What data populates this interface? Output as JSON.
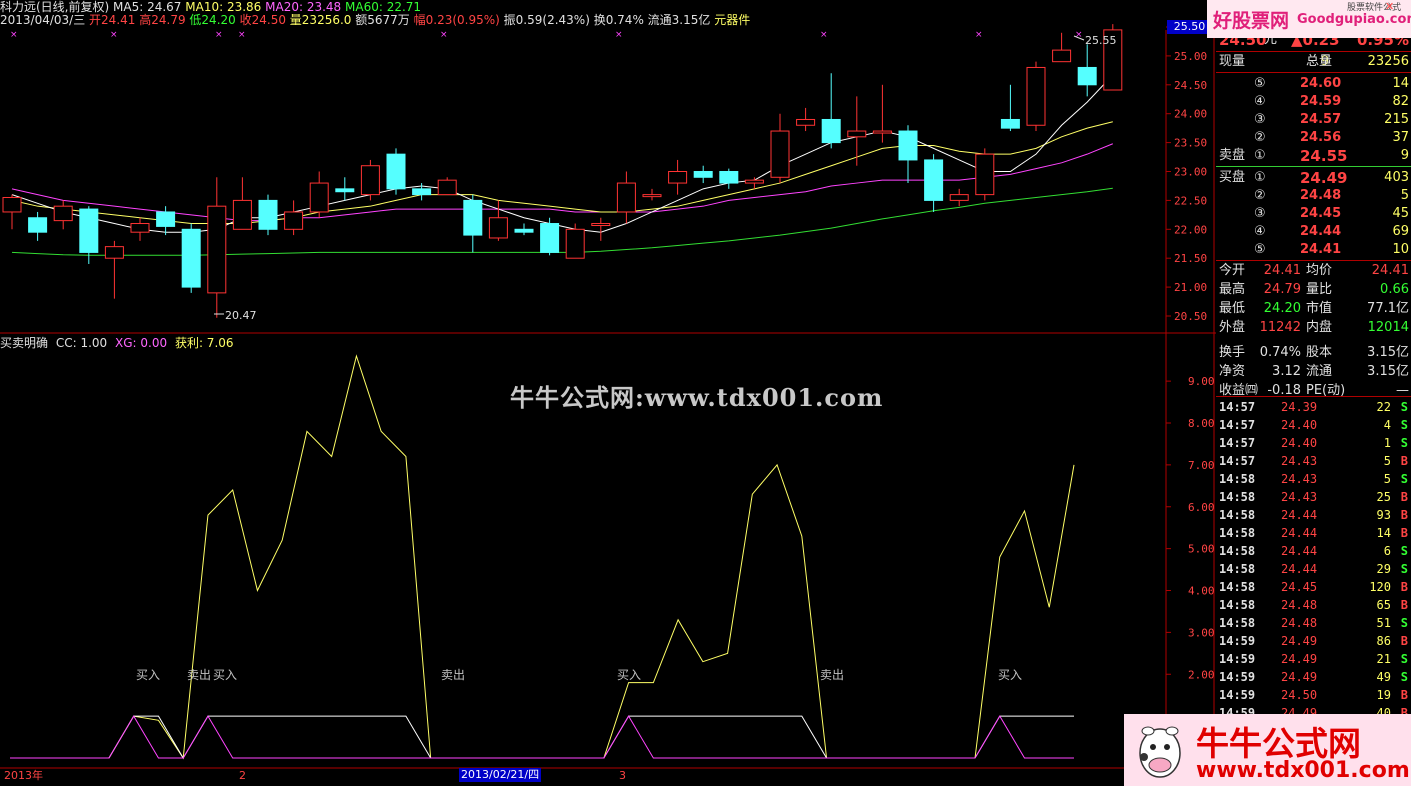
{
  "title": "科力远(日线,前复权)",
  "header": {
    "ma5": "MA5: 24.67",
    "ma10": "MA10: 23.86",
    "ma20": "MA20: 23.48",
    "ma60": "MA60: 22.71",
    "date": "2013/04/03/三",
    "open": "开24.41",
    "high": "高24.79",
    "low": "低24.20",
    "close": "收24.50",
    "vol": "量23256.0",
    "amount": "额5677万",
    "chg": "幅0.23(0.95%)",
    "amp": "振0.59(2.43%)",
    "turnover": "换0.74%",
    "float": "流通3.15亿",
    "sector": "元器件"
  },
  "price_axis": {
    "labels": [
      "25.50",
      "25.00",
      "24.50",
      "24.00",
      "23.50",
      "23.00",
      "22.50",
      "22.00",
      "21.50",
      "21.00",
      "20.50"
    ],
    "current_tag": "25.50",
    "high_mark": "25.55",
    "low_mark": "20.47"
  },
  "osc": {
    "name": "买卖明确",
    "cc": "CC: 1.00",
    "xg": "XG: 0.00",
    "profit": "获利: 7.06",
    "axis": [
      "9.00",
      "8.00",
      "7.00",
      "6.00",
      "5.00",
      "4.00",
      "3.00",
      "2.00"
    ],
    "signals": [
      {
        "text": "买入",
        "color": "#ff4444"
      },
      {
        "text": "卖出",
        "color": "#33ff33"
      },
      {
        "text": "买入",
        "color": "#ff4444"
      },
      {
        "text": "卖出",
        "color": "#33ff33"
      },
      {
        "text": "买入",
        "color": "#ff4444"
      },
      {
        "text": "卖出",
        "color": "#33ff33"
      },
      {
        "text": "买入",
        "color": "#ff4444"
      }
    ],
    "values": [
      0,
      0,
      0,
      0,
      0,
      1.0,
      0.9,
      0,
      5.8,
      6.4,
      4.0,
      5.2,
      7.8,
      7.2,
      9.6,
      7.8,
      7.2,
      0,
      0,
      0,
      0,
      0,
      0,
      0,
      0,
      1.8,
      1.8,
      3.3,
      2.3,
      2.5,
      6.3,
      7.0,
      5.3,
      0,
      0,
      0,
      0,
      0,
      0,
      0,
      4.8,
      5.9,
      3.6,
      7.0
    ]
  },
  "bottom_axis": {
    "year": "2013年",
    "m2": "2",
    "selected": "2013/02/21/四",
    "m3": "3"
  },
  "quote": {
    "price": "24.50",
    "unit": "元",
    "change": "▲0.23",
    "pct": "0.95%",
    "xianliang_label": "现量",
    "xianliang": "9",
    "zongliang_label": "总量",
    "zongliang": "23256",
    "sell_label": "卖盘",
    "buy_label": "买盘",
    "asks": [
      {
        "lvl": "⑤",
        "price": "24.60",
        "vol": "14"
      },
      {
        "lvl": "④",
        "price": "24.59",
        "vol": "82"
      },
      {
        "lvl": "③",
        "price": "24.57",
        "vol": "215"
      },
      {
        "lvl": "②",
        "price": "24.56",
        "vol": "37"
      },
      {
        "lvl": "①",
        "price": "24.55",
        "vol": "9"
      }
    ],
    "bids": [
      {
        "lvl": "①",
        "price": "24.49",
        "vol": "403"
      },
      {
        "lvl": "②",
        "price": "24.48",
        "vol": "5"
      },
      {
        "lvl": "③",
        "price": "24.45",
        "vol": "45"
      },
      {
        "lvl": "④",
        "price": "24.44",
        "vol": "69"
      },
      {
        "lvl": "⑤",
        "price": "24.41",
        "vol": "10"
      }
    ],
    "stats": [
      {
        "l1": "今开",
        "v1": "24.41",
        "l2": "均价",
        "v2": "24.41",
        "c1": "#ff4444",
        "c2": "#ff4444"
      },
      {
        "l1": "最高",
        "v1": "24.79",
        "l2": "量比",
        "v2": "0.66",
        "c1": "#ff4444",
        "c2": "#33ff33"
      },
      {
        "l1": "最低",
        "v1": "24.20",
        "l2": "市值",
        "v2": "77.1亿",
        "c1": "#33ff33",
        "c2": "#e0e0e0"
      },
      {
        "l1": "外盘",
        "v1": "11242",
        "l2": "内盘",
        "v2": "12014",
        "c1": "#ff4444",
        "c2": "#33ff33"
      },
      {
        "l1": "换手",
        "v1": "0.74%",
        "l2": "股本",
        "v2": "3.15亿",
        "c1": "#e0e0e0",
        "c2": "#e0e0e0"
      },
      {
        "l1": "净资",
        "v1": "3.12",
        "l2": "流通",
        "v2": "3.15亿",
        "c1": "#e0e0e0",
        "c2": "#e0e0e0"
      },
      {
        "l1": "收益㈣",
        "v1": "-0.18",
        "l2": "PE(动)",
        "v2": "—",
        "c1": "#e0e0e0",
        "c2": "#e0e0e0"
      }
    ],
    "ticks": [
      {
        "t": "14:57",
        "p": "24.39",
        "v": "22",
        "bs": "S"
      },
      {
        "t": "14:57",
        "p": "24.40",
        "v": "4",
        "bs": "S"
      },
      {
        "t": "14:57",
        "p": "24.40",
        "v": "1",
        "bs": "S"
      },
      {
        "t": "14:57",
        "p": "24.43",
        "v": "5",
        "bs": "B"
      },
      {
        "t": "14:58",
        "p": "24.43",
        "v": "5",
        "bs": "S"
      },
      {
        "t": "14:58",
        "p": "24.43",
        "v": "25",
        "bs": "B"
      },
      {
        "t": "14:58",
        "p": "24.44",
        "v": "93",
        "bs": "B"
      },
      {
        "t": "14:58",
        "p": "24.44",
        "v": "14",
        "bs": "B"
      },
      {
        "t": "14:58",
        "p": "24.44",
        "v": "6",
        "bs": "S"
      },
      {
        "t": "14:58",
        "p": "24.44",
        "v": "29",
        "bs": "S"
      },
      {
        "t": "14:58",
        "p": "24.45",
        "v": "120",
        "bs": "B"
      },
      {
        "t": "14:58",
        "p": "24.48",
        "v": "65",
        "bs": "B"
      },
      {
        "t": "14:58",
        "p": "24.48",
        "v": "51",
        "bs": "S"
      },
      {
        "t": "14:59",
        "p": "24.49",
        "v": "86",
        "bs": "B"
      },
      {
        "t": "14:59",
        "p": "24.49",
        "v": "21",
        "bs": "S"
      },
      {
        "t": "14:59",
        "p": "24.49",
        "v": "49",
        "bs": "S"
      },
      {
        "t": "14:59",
        "p": "24.50",
        "v": "19",
        "bs": "B"
      },
      {
        "t": "14:59",
        "p": "24.49",
        "v": "40",
        "bs": "B"
      }
    ]
  },
  "watermark": "牛牛公式网:www.tdx001.com",
  "brand_top": "好股票网",
  "brand_top_url": "Goodgupiao.com",
  "brand_top_sub": "股票软件公式",
  "brand_bottom": "牛牛公式网",
  "brand_bottom_url": "www.tdx001.com",
  "candles": [
    {
      "o": 22.3,
      "c": 22.55,
      "h": 22.6,
      "l": 22.0
    },
    {
      "o": 22.2,
      "c": 21.95,
      "h": 22.3,
      "l": 21.8
    },
    {
      "o": 22.15,
      "c": 22.4,
      "h": 22.5,
      "l": 22.0
    },
    {
      "o": 22.35,
      "c": 21.6,
      "h": 22.4,
      "l": 21.4
    },
    {
      "o": 21.5,
      "c": 21.7,
      "h": 21.8,
      "l": 20.8
    },
    {
      "o": 21.95,
      "c": 22.1,
      "h": 22.2,
      "l": 21.8
    },
    {
      "o": 22.3,
      "c": 22.05,
      "h": 22.4,
      "l": 21.9
    },
    {
      "o": 22.0,
      "c": 21.0,
      "h": 22.1,
      "l": 20.9
    },
    {
      "o": 20.9,
      "c": 22.4,
      "h": 22.9,
      "l": 20.47
    },
    {
      "o": 22.0,
      "c": 22.5,
      "h": 22.9,
      "l": 22.0
    },
    {
      "o": 22.5,
      "c": 22.0,
      "h": 22.6,
      "l": 21.9
    },
    {
      "o": 22.0,
      "c": 22.3,
      "h": 22.5,
      "l": 21.9
    },
    {
      "o": 22.3,
      "c": 22.8,
      "h": 23.0,
      "l": 22.2
    },
    {
      "o": 22.7,
      "c": 22.65,
      "h": 22.9,
      "l": 22.5
    },
    {
      "o": 22.6,
      "c": 23.1,
      "h": 23.2,
      "l": 22.5
    },
    {
      "o": 23.3,
      "c": 22.7,
      "h": 23.4,
      "l": 22.6
    },
    {
      "o": 22.7,
      "c": 22.6,
      "h": 22.8,
      "l": 22.5
    },
    {
      "o": 22.6,
      "c": 22.85,
      "h": 22.9,
      "l": 22.6
    },
    {
      "o": 22.5,
      "c": 21.9,
      "h": 22.6,
      "l": 21.6
    },
    {
      "o": 21.85,
      "c": 22.2,
      "h": 22.5,
      "l": 21.8
    },
    {
      "o": 22.0,
      "c": 21.95,
      "h": 22.1,
      "l": 21.9
    },
    {
      "o": 22.1,
      "c": 21.6,
      "h": 22.2,
      "l": 21.55
    },
    {
      "o": 21.5,
      "c": 22.0,
      "h": 22.1,
      "l": 21.5
    },
    {
      "o": 22.1,
      "c": 22.1,
      "h": 22.2,
      "l": 21.8
    },
    {
      "o": 22.3,
      "c": 22.8,
      "h": 23.0,
      "l": 22.1
    },
    {
      "o": 22.6,
      "c": 22.6,
      "h": 22.7,
      "l": 22.5
    },
    {
      "o": 22.8,
      "c": 23.0,
      "h": 23.2,
      "l": 22.6
    },
    {
      "o": 23.0,
      "c": 22.9,
      "h": 23.1,
      "l": 22.8
    },
    {
      "o": 23.0,
      "c": 22.8,
      "h": 23.05,
      "l": 22.7
    },
    {
      "o": 22.8,
      "c": 22.85,
      "h": 22.9,
      "l": 22.7
    },
    {
      "o": 22.9,
      "c": 23.7,
      "h": 24.0,
      "l": 22.8
    },
    {
      "o": 23.8,
      "c": 23.9,
      "h": 24.1,
      "l": 23.7
    },
    {
      "o": 23.9,
      "c": 23.5,
      "h": 24.7,
      "l": 23.4
    },
    {
      "o": 23.6,
      "c": 23.7,
      "h": 24.3,
      "l": 23.1
    },
    {
      "o": 23.7,
      "c": 23.7,
      "h": 24.5,
      "l": 23.5
    },
    {
      "o": 23.7,
      "c": 23.2,
      "h": 23.8,
      "l": 22.8
    },
    {
      "o": 23.2,
      "c": 22.5,
      "h": 23.3,
      "l": 22.3
    },
    {
      "o": 22.5,
      "c": 22.6,
      "h": 22.7,
      "l": 22.4
    },
    {
      "o": 22.6,
      "c": 23.3,
      "h": 23.4,
      "l": 22.5
    },
    {
      "o": 23.9,
      "c": 23.75,
      "h": 24.5,
      "l": 23.7
    },
    {
      "o": 23.8,
      "c": 24.8,
      "h": 24.9,
      "l": 23.7
    },
    {
      "o": 24.9,
      "c": 25.1,
      "h": 25.4,
      "l": 24.9
    },
    {
      "o": 24.8,
      "c": 24.5,
      "h": 25.2,
      "l": 24.3
    },
    {
      "o": 24.41,
      "c": 25.45,
      "h": 25.55,
      "l": 24.41
    }
  ],
  "ma_series": {
    "ma5": [
      22.6,
      22.45,
      22.3,
      22.2,
      22.1,
      22.0,
      21.95,
      21.95,
      22.0,
      22.2,
      22.2,
      22.3,
      22.4,
      22.5,
      22.6,
      22.7,
      22.75,
      22.7,
      22.5,
      22.35,
      22.2,
      22.1,
      22.0,
      21.95,
      22.1,
      22.3,
      22.5,
      22.7,
      22.8,
      22.85,
      23.1,
      23.3,
      23.5,
      23.6,
      23.7,
      23.6,
      23.4,
      23.2,
      23.0,
      23.0,
      23.3,
      23.8,
      24.2,
      24.67
    ],
    "ma10": [
      22.5,
      22.4,
      22.35,
      22.3,
      22.25,
      22.2,
      22.15,
      22.1,
      22.1,
      22.1,
      22.15,
      22.2,
      22.3,
      22.35,
      22.4,
      22.5,
      22.6,
      22.6,
      22.6,
      22.5,
      22.45,
      22.4,
      22.35,
      22.3,
      22.3,
      22.35,
      22.4,
      22.5,
      22.6,
      22.7,
      22.8,
      22.95,
      23.1,
      23.25,
      23.4,
      23.45,
      23.45,
      23.35,
      23.3,
      23.3,
      23.4,
      23.6,
      23.75,
      23.86
    ],
    "ma20": [
      22.7,
      22.6,
      22.5,
      22.45,
      22.4,
      22.35,
      22.3,
      22.25,
      22.2,
      22.15,
      22.15,
      22.2,
      22.2,
      22.25,
      22.3,
      22.35,
      22.35,
      22.35,
      22.35,
      22.35,
      22.35,
      22.35,
      22.3,
      22.3,
      22.3,
      22.3,
      22.35,
      22.4,
      22.5,
      22.55,
      22.6,
      22.65,
      22.75,
      22.8,
      22.85,
      22.85,
      22.85,
      22.85,
      22.9,
      22.95,
      23.05,
      23.15,
      23.3,
      23.48
    ],
    "ma60": [
      21.6,
      21.58,
      21.56,
      21.55,
      21.55,
      21.55,
      21.55,
      21.55,
      21.56,
      21.57,
      21.58,
      21.59,
      21.6,
      21.6,
      21.6,
      21.6,
      21.6,
      21.6,
      21.6,
      21.6,
      21.6,
      21.6,
      21.6,
      21.62,
      21.65,
      21.68,
      21.72,
      21.76,
      21.8,
      21.85,
      21.9,
      21.96,
      22.02,
      22.1,
      22.18,
      22.25,
      22.32,
      22.38,
      22.45,
      22.5,
      22.55,
      22.6,
      22.65,
      22.71
    ]
  },
  "colors": {
    "up": "#ff3333",
    "down": "#55ffff",
    "ma5": "#ffffff",
    "ma10": "#ffff66",
    "ma20": "#ff44ff",
    "ma60": "#33dd33",
    "grid": "#b00000"
  }
}
